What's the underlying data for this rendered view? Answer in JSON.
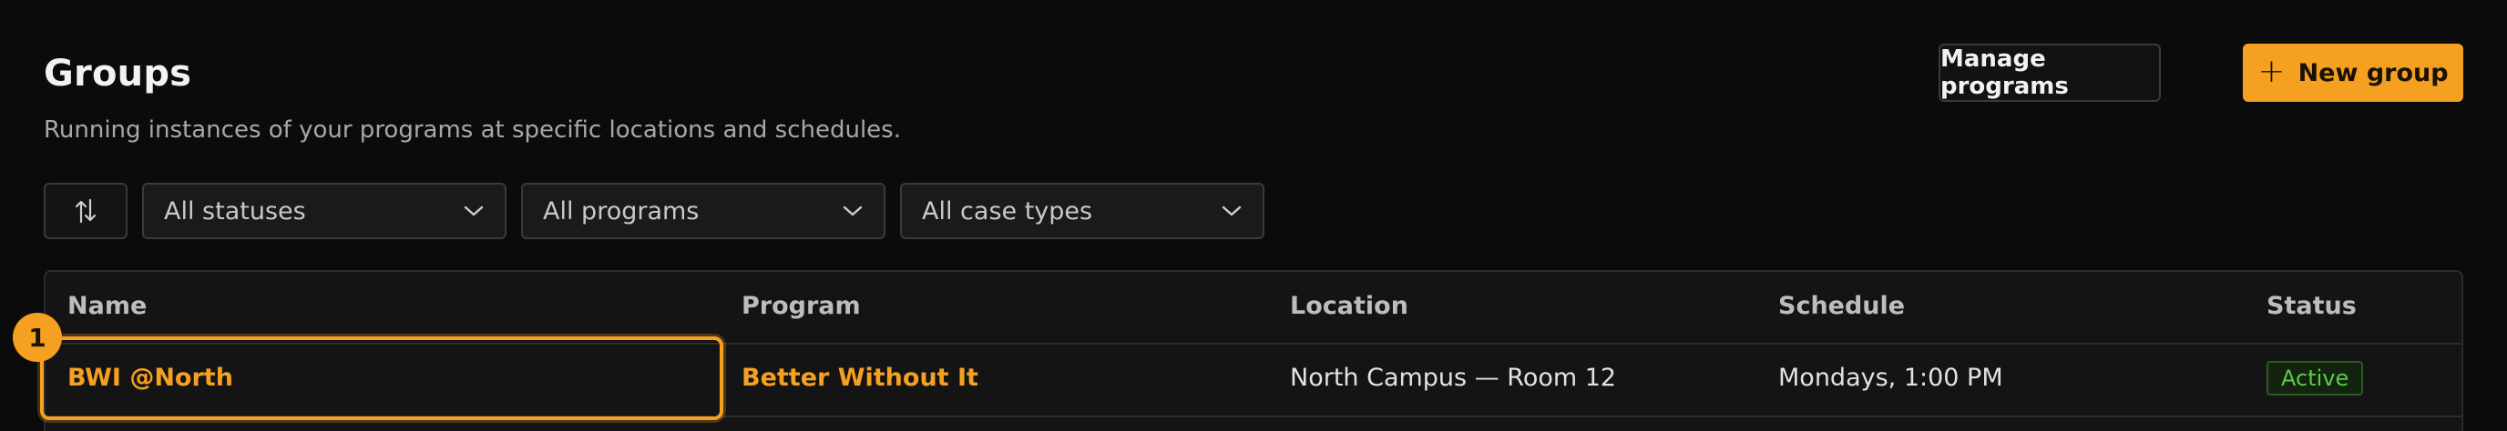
{
  "header": {
    "title": "Groups",
    "subtitle": "Running instances of your programs at specific locations and schedules.",
    "manage_label": "Manage programs",
    "new_label": "New group"
  },
  "filters": {
    "sort_icon": "sort-arrows-icon",
    "status": "All statuses",
    "program": "All programs",
    "case_type": "All case types"
  },
  "table": {
    "columns": [
      "Name",
      "Program",
      "Location",
      "Schedule",
      "Status"
    ],
    "rows": [
      {
        "name": "BWI @North",
        "program": "Better Without It",
        "location": "North Campus — Room 12",
        "schedule": "Mondays, 1:00 PM",
        "status": "Active"
      }
    ]
  },
  "annotation": {
    "marker": "1"
  },
  "colors": {
    "accent": "#f5a020",
    "background": "#0b0b0b",
    "status_active": "#5cc94a"
  }
}
